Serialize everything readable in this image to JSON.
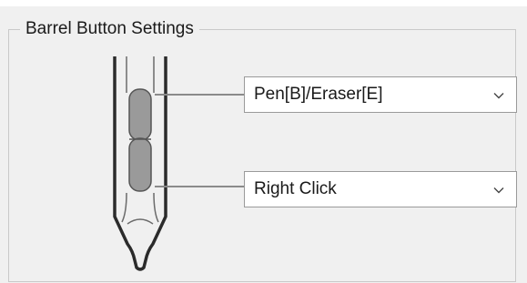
{
  "group": {
    "title": "Barrel Button Settings"
  },
  "upper_button": {
    "value": "Pen[B]/Eraser[E]",
    "icon": "chevron-down-icon"
  },
  "lower_button": {
    "value": "Right Click",
    "icon": "chevron-down-icon"
  },
  "colors": {
    "pen_outline": "#2b2b2b",
    "barrel_button_fill": "#9a9a9a",
    "leader_line": "#8a8a8a",
    "dropdown_border": "#9a9a9a",
    "panel_bg": "#f0f0f0"
  }
}
